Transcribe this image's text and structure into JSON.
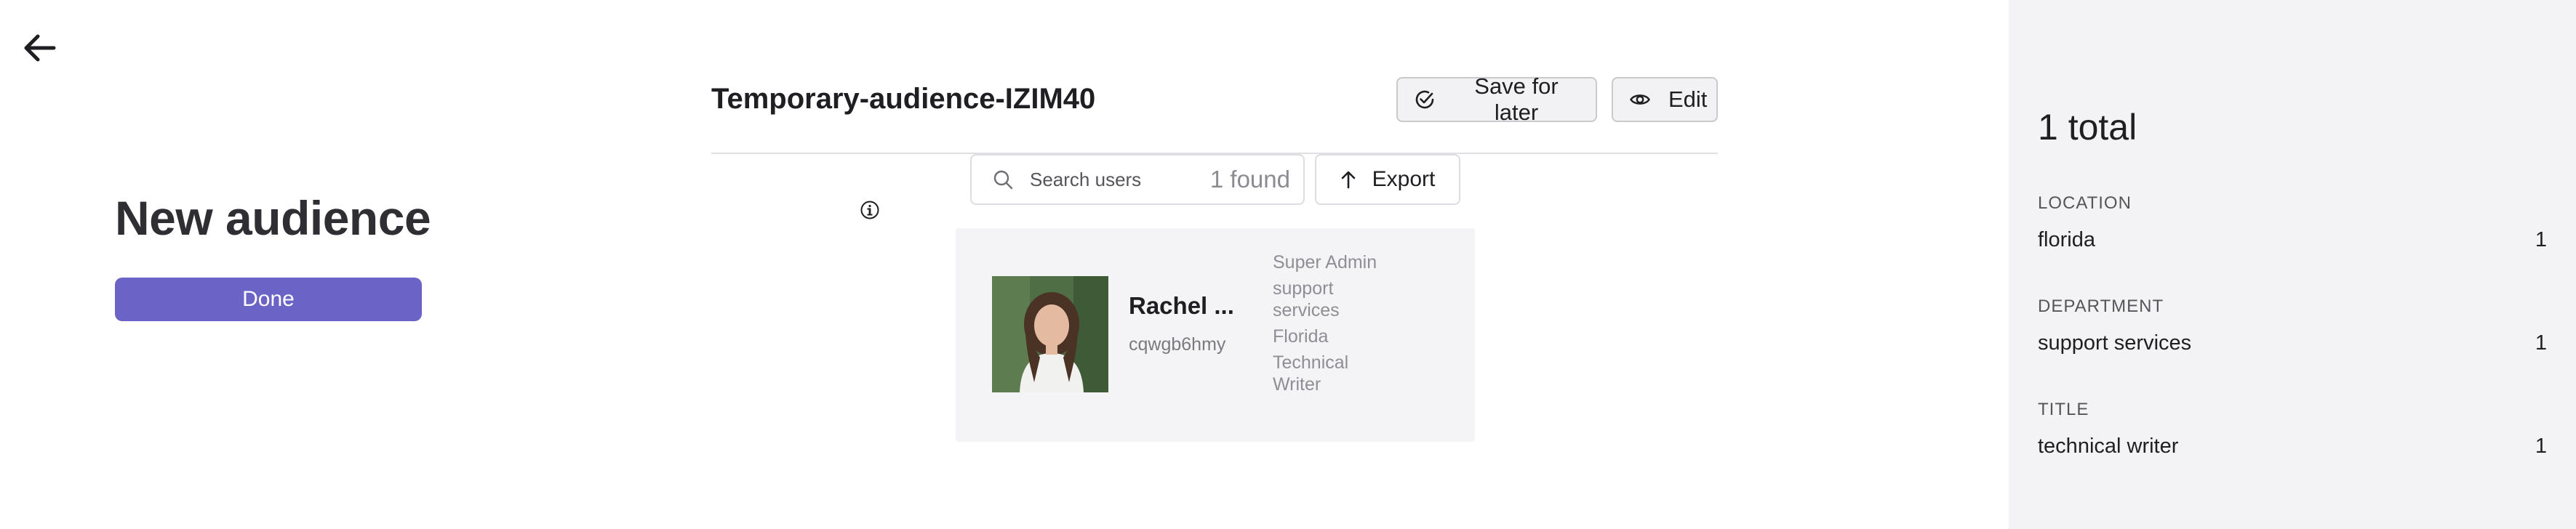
{
  "nav": {
    "back_icon": "arrow-left-icon"
  },
  "page": {
    "heading": "New audience",
    "done_label": "Done"
  },
  "audience": {
    "name": "Temporary-audience-IZIM40",
    "save_label": "Save for later",
    "save_icon": "check-circle-icon",
    "edit_label": "Edit",
    "edit_icon": "eye-icon"
  },
  "search": {
    "placeholder": "Search users",
    "value": "",
    "found": "1 found",
    "icon": "search-icon"
  },
  "export": {
    "label": "Export",
    "icon": "arrow-up-icon"
  },
  "info": {
    "icon": "info-icon"
  },
  "users": [
    {
      "name": "Rachel ...",
      "id": "cqwgb6hmy",
      "role": "Super Admin",
      "department": "support services",
      "location": "Florida",
      "title": "Technical Writer"
    }
  ],
  "summary": {
    "total": "1 total",
    "facets": [
      {
        "label": "LOCATION",
        "value": "florida",
        "count": "1"
      },
      {
        "label": "DEPARTMENT",
        "value": "support services",
        "count": "1"
      },
      {
        "label": "TITLE",
        "value": "technical writer",
        "count": "1"
      }
    ]
  },
  "colors": {
    "accent": "#6c63c7",
    "panel": "#f3f3f5",
    "card": "#f4f4f6"
  }
}
